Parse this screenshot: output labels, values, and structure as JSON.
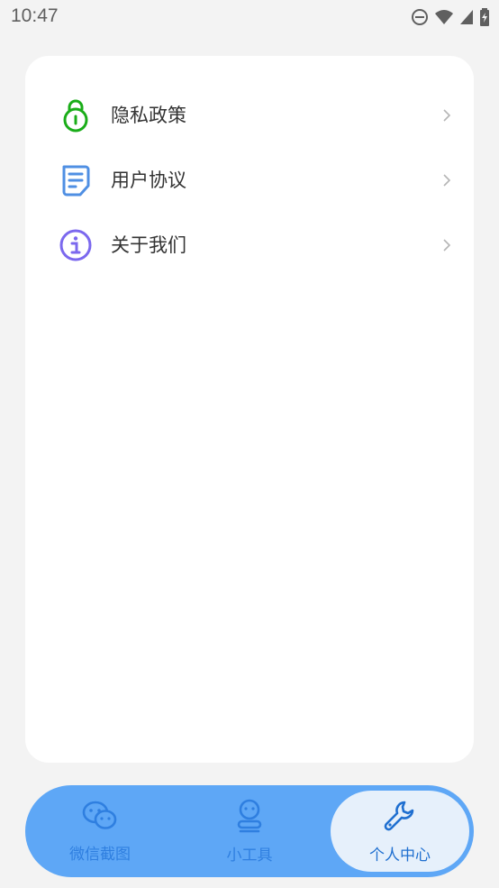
{
  "status_bar": {
    "time": "10:47"
  },
  "menu": {
    "items": [
      {
        "label": "隐私政策",
        "icon": "lock-icon",
        "color": "#1aad19"
      },
      {
        "label": "用户协议",
        "icon": "document-icon",
        "color": "#4f8fe3"
      },
      {
        "label": "关于我们",
        "icon": "info-icon",
        "color": "#7b68ee"
      }
    ]
  },
  "bottom_nav": {
    "items": [
      {
        "label": "微信截图",
        "icon": "wechat-icon"
      },
      {
        "label": "小工具",
        "icon": "tool-person-icon"
      },
      {
        "label": "个人中心",
        "icon": "wrench-icon"
      }
    ],
    "active_index": 2
  },
  "colors": {
    "background": "#f3f3f3",
    "card": "#ffffff",
    "nav_background": "#5ea7f6",
    "nav_active": "#e6f0fb",
    "nav_text": "#2f7fe0"
  }
}
